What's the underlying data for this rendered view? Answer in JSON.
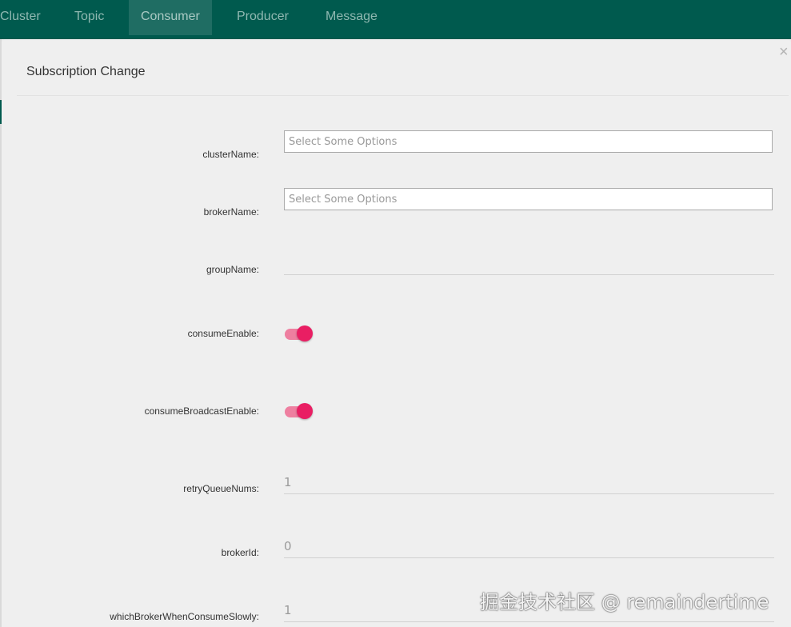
{
  "nav": {
    "items": [
      {
        "label": "Cluster"
      },
      {
        "label": "Topic"
      },
      {
        "label": "Consumer",
        "active": true
      },
      {
        "label": "Producer"
      },
      {
        "label": "Message"
      }
    ]
  },
  "modal": {
    "title": "Subscription Change",
    "close_symbol": "×",
    "fields": {
      "clusterName": {
        "label": "clusterName:",
        "placeholder": "Select Some Options"
      },
      "brokerName": {
        "label": "brokerName:",
        "placeholder": "Select Some Options"
      },
      "groupName": {
        "label": "groupName:",
        "value": ""
      },
      "consumeEnable": {
        "label": "consumeEnable:",
        "on": true
      },
      "consumeBroadcastEnable": {
        "label": "consumeBroadcastEnable:",
        "on": true
      },
      "retryQueueNums": {
        "label": "retryQueueNums:",
        "value": "1"
      },
      "brokerId": {
        "label": "brokerId:",
        "value": "0"
      },
      "whichBrokerWhenConsumeSlowly": {
        "label": "whichBrokerWhenConsumeSlowly:",
        "value": "1"
      }
    }
  },
  "watermark": {
    "text": "掘金技术社区 @ remaindertime"
  },
  "colors": {
    "navbar": "#005a4e",
    "toggle_on": "#e91e63",
    "modal_bg": "#efefef"
  }
}
